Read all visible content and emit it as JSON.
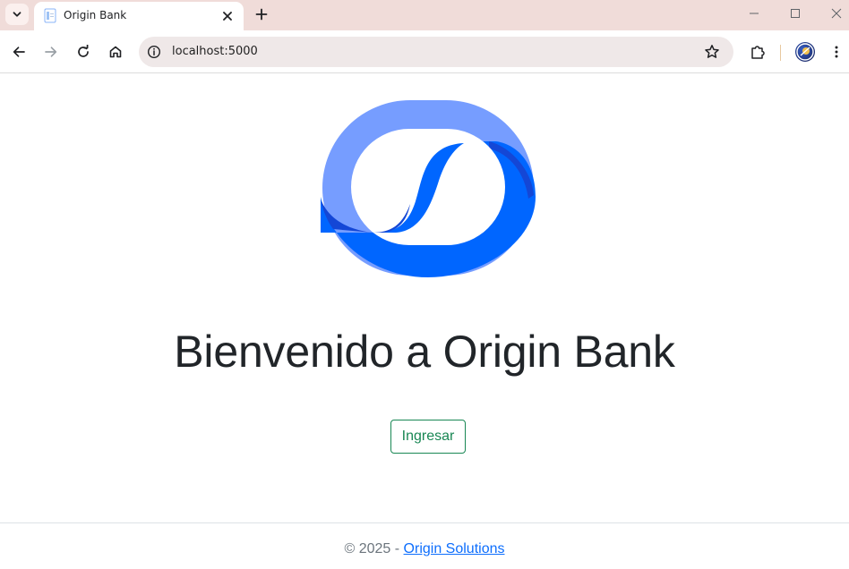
{
  "browser": {
    "tab_title": "Origin Bank",
    "url": "localhost:5000"
  },
  "icons": {
    "tab_search": "chevron-down-icon",
    "tab_close": "close-icon",
    "new_tab": "plus-icon",
    "back": "arrow-left-icon",
    "forward": "arrow-right-icon",
    "reload": "reload-icon",
    "home": "home-icon",
    "site_info": "info-icon",
    "bookmark": "star-icon",
    "extensions": "puzzle-icon",
    "menu": "kebab-menu-icon"
  },
  "page": {
    "heading": "Bienvenido a Origin Bank",
    "login_button": "Ingresar",
    "footer_prefix": "© 2025 - ",
    "footer_link": "Origin Solutions"
  },
  "colors": {
    "logo_light": "#769dff",
    "logo_main": "#0066ff",
    "logo_dark": "#1447d6",
    "button": "#198754",
    "link": "#0d6efd"
  }
}
